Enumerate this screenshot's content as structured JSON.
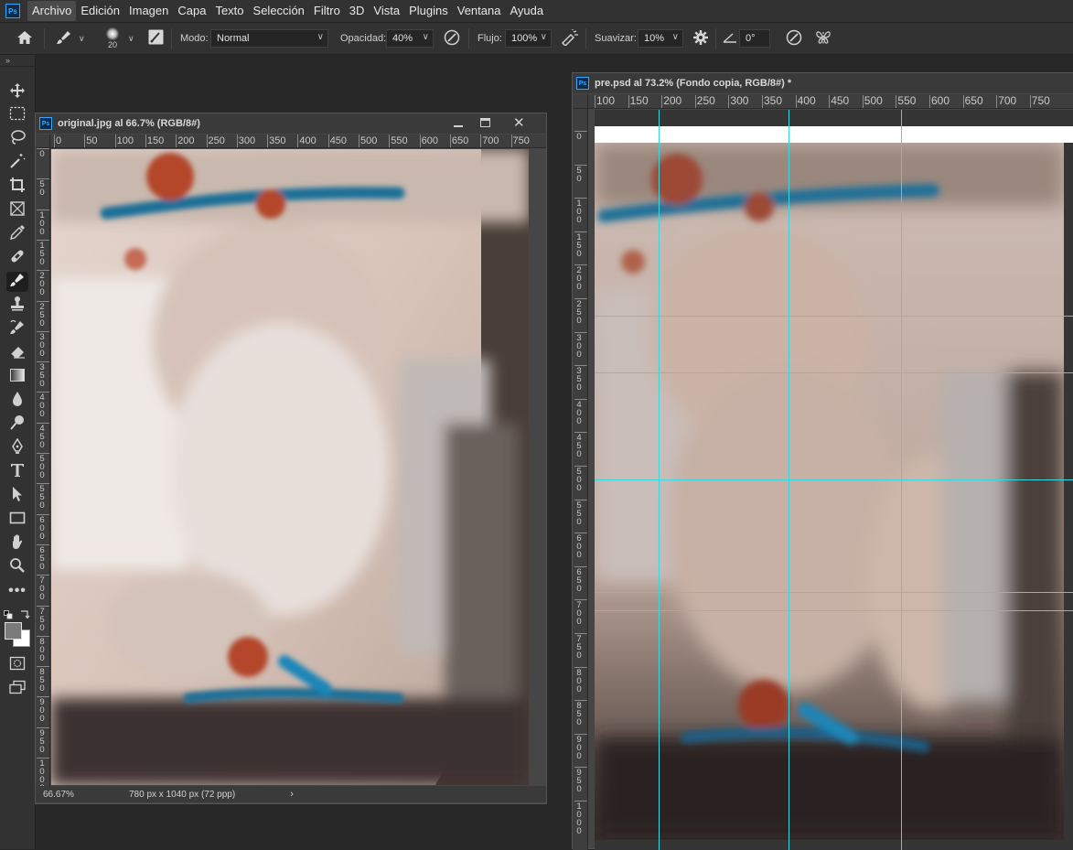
{
  "app": {
    "logo": "Ps"
  },
  "menu": [
    "Archivo",
    "Edición",
    "Imagen",
    "Capa",
    "Texto",
    "Selección",
    "Filtro",
    "3D",
    "Vista",
    "Plugins",
    "Ventana",
    "Ayuda"
  ],
  "options": {
    "brush_size": "20",
    "mode_label": "Modo:",
    "mode_value": "Normal",
    "opacity_label": "Opacidad:",
    "opacity_value": "40%",
    "flow_label": "Flujo:",
    "flow_value": "100%",
    "smooth_label": "Suavizar:",
    "smooth_value": "10%",
    "angle_value": "0°"
  },
  "original": {
    "title": "original.jpg al 66.7% (RGB/8#)",
    "ruler_h": [
      "0",
      "50",
      "100",
      "150",
      "200",
      "250",
      "300",
      "350",
      "400",
      "450",
      "500",
      "550",
      "600",
      "650",
      "700",
      "750"
    ],
    "ruler_v": [
      "0",
      "50",
      "100",
      "150",
      "200",
      "250",
      "300",
      "350",
      "400",
      "450",
      "500",
      "550",
      "600",
      "650",
      "700",
      "750",
      "800",
      "850",
      "900",
      "950",
      "1000"
    ],
    "zoom": "66.67%",
    "doc_info": "780 px x 1040 px (72 ppp)"
  },
  "pre": {
    "title": "pre.psd al 73.2% (Fondo copia, RGB/8#) *",
    "ruler_h": [
      "100",
      "150",
      "200",
      "250",
      "300",
      "350",
      "400",
      "450",
      "500",
      "550",
      "600",
      "650",
      "700",
      "750"
    ],
    "ruler_v": [
      "0",
      "50",
      "100",
      "150",
      "200",
      "250",
      "300",
      "350",
      "400",
      "450",
      "500",
      "550",
      "600",
      "650",
      "700",
      "750",
      "800",
      "850",
      "900",
      "950",
      "1000"
    ]
  },
  "colors": {
    "guide": "#3ad7e0",
    "paint_blue": "#1f6f98",
    "paint_red": "#b4462b"
  }
}
